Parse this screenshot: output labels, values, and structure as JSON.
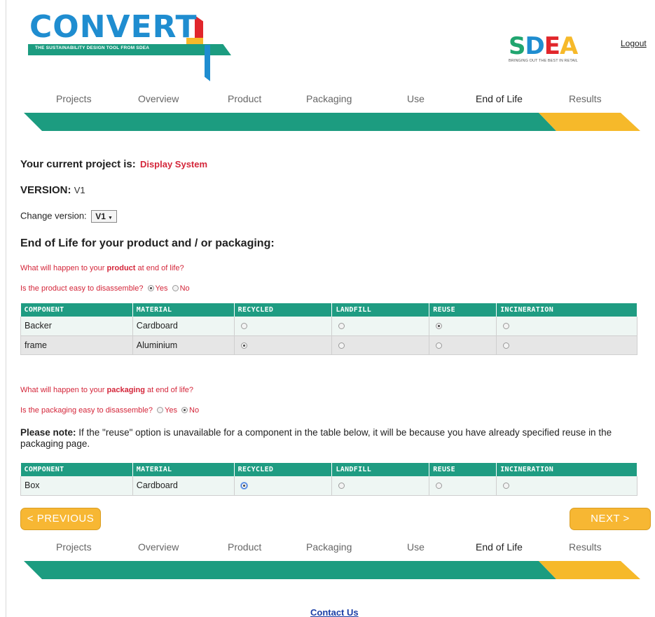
{
  "header": {
    "logo_title": "CONVERT",
    "logo_tagline": "THE SUSTAINABILITY DESIGN TOOL FROM SDEA",
    "partner_logo": {
      "letters": [
        "S",
        "D",
        "E",
        "A"
      ],
      "tagline": "BRINGING OUT THE BEST IN RETAIL"
    },
    "logout_label": "Logout"
  },
  "steps": {
    "items": [
      "Projects",
      "Overview",
      "Product",
      "Packaging",
      "Use",
      "End of Life",
      "Results"
    ],
    "active": "End of Life",
    "colors": {
      "completed": "#1c9c80",
      "current": "#f6b92a"
    }
  },
  "project": {
    "label": "Your current project is:",
    "name": "Display System",
    "version_label": "VERSION:",
    "version": "V1",
    "change_label": "Change version:",
    "change_selected": "V1"
  },
  "section_title": "End of Life for your product and / or packaging:",
  "product": {
    "question_pre": "What will happen to your ",
    "question_bold": "product",
    "question_post": " at end of life?",
    "disassemble_q": "Is the product easy to disassemble?",
    "yes_label": "Yes",
    "no_label": "No",
    "disassemble_answer": "Yes"
  },
  "packaging": {
    "question_pre": "What will happen to your ",
    "question_bold": "packaging",
    "question_post": " at end of life?",
    "disassemble_q": "Is the packaging easy to disassemble?",
    "yes_label": "Yes",
    "no_label": "No",
    "disassemble_answer": "No"
  },
  "table_headers": [
    "COMPONENT",
    "MATERIAL",
    "RECYCLED",
    "LANDFILL",
    "REUSE",
    "INCINERATION"
  ],
  "product_rows": [
    {
      "component": "Backer",
      "material": "Cardboard",
      "choice": "REUSE"
    },
    {
      "component": "frame",
      "material": "Aluminium",
      "choice": "RECYCLED"
    }
  ],
  "note": {
    "bold": "Please note:",
    "text": " If the \"reuse\" option is unavailable for a component in the table below, it will be because you have already specified reuse in the packaging page."
  },
  "packaging_rows": [
    {
      "component": "Box",
      "material": "Cardboard",
      "choice": "RECYCLED"
    }
  ],
  "buttons": {
    "previous": "< PREVIOUS",
    "next": "NEXT >"
  },
  "footer": {
    "contact": "Contact Us"
  },
  "colors": {
    "accent_green": "#1f9c82",
    "accent_yellow": "#f7b733",
    "accent_red": "#d4263a",
    "link_blue": "#1a3ea6"
  }
}
